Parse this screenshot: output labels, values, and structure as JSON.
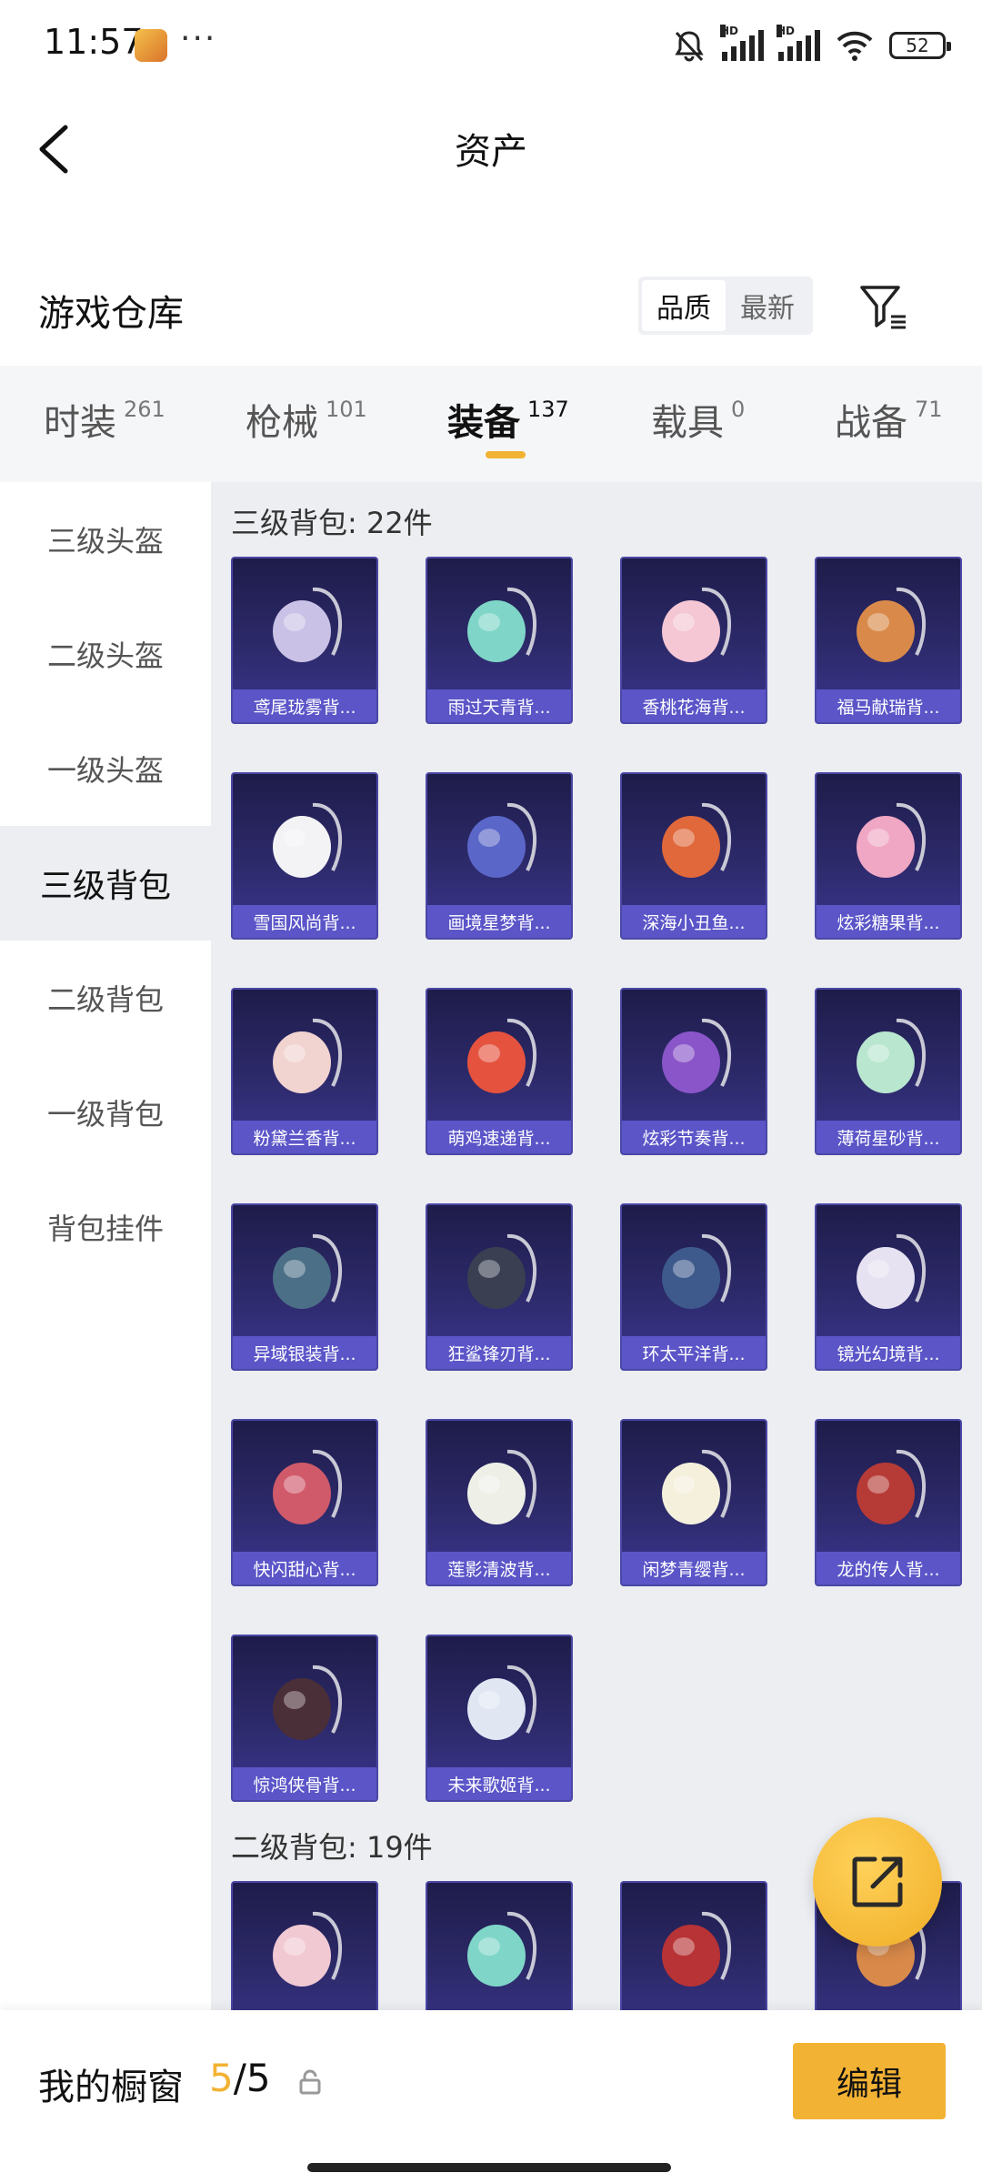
{
  "status": {
    "time": "11:57",
    "dots": "···",
    "battery": "52"
  },
  "header": {
    "title": "资产"
  },
  "warehouse": {
    "title": "游戏仓库",
    "sort": [
      "品质",
      "最新"
    ]
  },
  "tabs": [
    {
      "name": "时装",
      "count": "261"
    },
    {
      "name": "枪械",
      "count": "101"
    },
    {
      "name": "装备",
      "count": "137"
    },
    {
      "name": "载具",
      "count": "0"
    },
    {
      "name": "战备",
      "count": "71"
    }
  ],
  "sidebar": [
    "三级头盔",
    "二级头盔",
    "一级头盔",
    "三级背包",
    "二级背包",
    "一级背包",
    "背包挂件"
  ],
  "sections": [
    {
      "title": "三级背包: 22件",
      "items": [
        {
          "name": "鸢尾珑雾背...",
          "color": "#c9c2e6"
        },
        {
          "name": "雨过天青背...",
          "color": "#7fd6c8"
        },
        {
          "name": "香桃花海背...",
          "color": "#f5c6d4"
        },
        {
          "name": "福马献瑞背...",
          "color": "#d98a4a"
        },
        {
          "name": "雪国风尚背...",
          "color": "#f3f3f6"
        },
        {
          "name": "画境星梦背...",
          "color": "#5a66c8"
        },
        {
          "name": "深海小丑鱼...",
          "color": "#e0683a"
        },
        {
          "name": "炫彩糖果背...",
          "color": "#f0a7c4"
        },
        {
          "name": "粉黛兰香背...",
          "color": "#f1d3d0"
        },
        {
          "name": "萌鸡速递背...",
          "color": "#e5533f"
        },
        {
          "name": "炫彩节奏背...",
          "color": "#8a55c9"
        },
        {
          "name": "薄荷星砂背...",
          "color": "#b9e6cf"
        },
        {
          "name": "异域银装背...",
          "color": "#4b6f86"
        },
        {
          "name": "狂鲨锋刃背...",
          "color": "#3a3f52"
        },
        {
          "name": "环太平洋背...",
          "color": "#3e5a8c"
        },
        {
          "name": "镜光幻境背...",
          "color": "#e6e2f2"
        },
        {
          "name": "快闪甜心背...",
          "color": "#d05a6a"
        },
        {
          "name": "莲影清波背...",
          "color": "#eef0e8"
        },
        {
          "name": "闲梦青缨背...",
          "color": "#f4f0dc"
        },
        {
          "name": "龙的传人背...",
          "color": "#b63b36"
        },
        {
          "name": "惊鸿侠骨背...",
          "color": "#4a2f38"
        },
        {
          "name": "未来歌姬背...",
          "color": "#e0e7f3"
        }
      ]
    },
    {
      "title": "二级背包: 19件",
      "items": [
        {
          "name": "",
          "color": "#f1c9d3"
        },
        {
          "name": "",
          "color": "#7fd6c8"
        },
        {
          "name": "",
          "color": "#b83335"
        },
        {
          "name": "",
          "color": "#d98a4a"
        }
      ]
    }
  ],
  "bottom": {
    "label": "我的橱窗",
    "current": "5",
    "total": "/5",
    "edit": "编辑"
  },
  "colors": {
    "accent": "#f2b233",
    "card": "#2d2a6b",
    "card_label": "#5b55c8"
  }
}
